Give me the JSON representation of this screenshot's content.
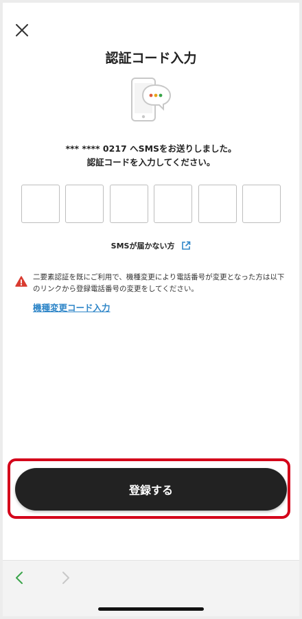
{
  "header": {
    "close_icon": "close-icon",
    "title": "認証コード入力"
  },
  "hero": {
    "icon": "phone-sms-icon",
    "dot_colors": [
      "#e05a3a",
      "#e8a317",
      "#3aa54a"
    ]
  },
  "message": {
    "line1": "*** **** 0217 へSMSをお送りしました。",
    "line2": "認証コードを入力してください。"
  },
  "code_input": {
    "digits": [
      "",
      "",
      "",
      "",
      "",
      ""
    ]
  },
  "sms_help": {
    "label": "SMSが届かない方",
    "icon": "external-link-icon"
  },
  "warning": {
    "icon": "warning-icon",
    "text": "二要素認証を既にご利用で、機種変更により電話番号が変更となった方は以下のリンクから登録電話番号の変更をしてください。",
    "link_label": "機種変更コード入力"
  },
  "footer": {
    "register_label": "登録する"
  },
  "browser_nav": {
    "back_icon": "chevron-left-icon",
    "forward_icon": "chevron-right-icon"
  },
  "colors": {
    "accent_link": "#2f86c8",
    "highlight_border": "#d4001a",
    "button_bg": "#222222",
    "warning_red": "#d93b30"
  }
}
